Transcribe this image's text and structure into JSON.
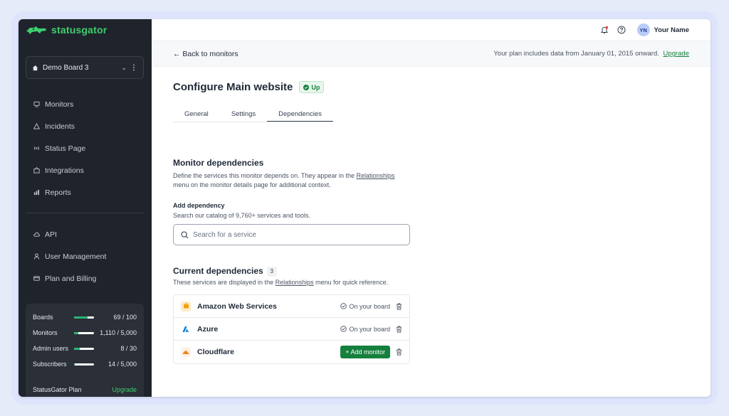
{
  "app": {
    "name": "statusgator"
  },
  "sidebar": {
    "board": "Demo Board 3",
    "nav_primary": [
      {
        "label": "Monitors",
        "icon": "monitor-icon"
      },
      {
        "label": "Incidents",
        "icon": "warning-icon"
      },
      {
        "label": "Status Page",
        "icon": "broadcast-icon"
      },
      {
        "label": "Integrations",
        "icon": "puzzle-icon"
      },
      {
        "label": "Reports",
        "icon": "bar-chart-icon"
      }
    ],
    "nav_secondary": [
      {
        "label": "API",
        "icon": "cloud-icon"
      },
      {
        "label": "User Management",
        "icon": "user-icon"
      },
      {
        "label": "Plan and Billing",
        "icon": "credit-card-icon"
      }
    ],
    "usage": [
      {
        "label": "Boards",
        "value": "69 / 100",
        "fraction": 0.69
      },
      {
        "label": "Monitors",
        "value": "1,110 / 5,000",
        "fraction": 0.22
      },
      {
        "label": "Admin users",
        "value": "8 / 30",
        "fraction": 0.27
      },
      {
        "label": "Subscribers",
        "value": "14 / 5,000",
        "fraction": 0.003
      }
    ],
    "plan": {
      "label": "StatusGator Plan",
      "upgrade": "Upgrade"
    }
  },
  "topbar": {
    "user_initials": "YN",
    "user_name": "Your Name"
  },
  "subbar": {
    "back": "← Back to monitors",
    "plan_note": "Your plan includes data from January 01, 2015 onward.",
    "upgrade": "Upgrade"
  },
  "page": {
    "title": "Configure Main website",
    "status": "Up",
    "tabs": [
      "General",
      "Settings",
      "Dependencies"
    ],
    "active_tab": "Dependencies"
  },
  "monitor_deps": {
    "heading": "Monitor dependencies",
    "desc_pre": "Define the services this monitor depends on. They appear in the ",
    "desc_link": "Relationships",
    "desc_post1": "menu on the monitor details page for additional context.",
    "add_label": "Add dependency",
    "add_help": "Search our catalog of 9,760+ services and tools.",
    "search_placeholder": "Search for a service"
  },
  "current_deps": {
    "heading": "Current dependencies",
    "count": "3",
    "desc_pre": "These services are displayed in the ",
    "desc_link": "Relationships",
    "desc_post": " menu for quick reference.",
    "items": [
      {
        "name": "Amazon Web Services",
        "state": "On your board",
        "logo_color": "#f59e0b"
      },
      {
        "name": "Azure",
        "state": "On your board",
        "logo_color": "#0078d4"
      },
      {
        "name": "Cloudflare",
        "action": "+ Add monitor",
        "logo_color": "#f38020"
      }
    ]
  },
  "colors": {
    "accent": "#15803d",
    "brand": "#3ecf6e",
    "sidebar_bg": "#1f232b"
  }
}
